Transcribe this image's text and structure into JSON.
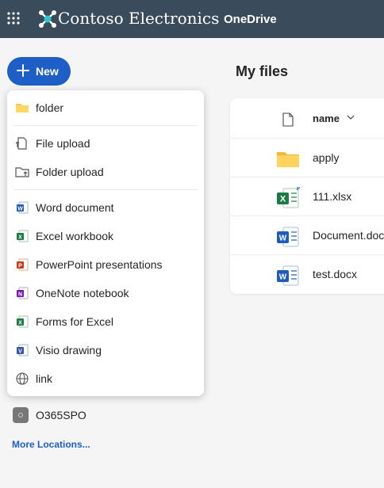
{
  "header": {
    "brand": "Contoso Electronics",
    "app_name": "OneDrive",
    "brand_color": "#3a4b5c"
  },
  "new_button": {
    "label": "New",
    "color": "#1d5fc6"
  },
  "new_menu": {
    "items": [
      {
        "label": "folder",
        "icon": "folder-icon"
      },
      {
        "label": "File upload",
        "icon": "file-upload-icon"
      },
      {
        "label": "Folder upload",
        "icon": "folder-upload-icon"
      },
      {
        "label": "Word document",
        "icon": "word-icon"
      },
      {
        "label": "Excel workbook",
        "icon": "excel-icon"
      },
      {
        "label": "PowerPoint presentations",
        "icon": "powerpoint-icon"
      },
      {
        "label": "OneNote notebook",
        "icon": "onenote-icon"
      },
      {
        "label": "Forms for Excel",
        "icon": "forms-excel-icon"
      },
      {
        "label": "Visio drawing",
        "icon": "visio-icon"
      },
      {
        "label": "link",
        "icon": "globe-icon"
      }
    ]
  },
  "locations": {
    "site": "O365SPO",
    "more": "More Locations..."
  },
  "main": {
    "title": "My files",
    "column_name": "name",
    "files": [
      {
        "name": "apply",
        "icon": "folder-icon"
      },
      {
        "name": "111.xlsx",
        "icon": "excel-file-icon"
      },
      {
        "name": "Document.docx",
        "icon": "word-file-icon"
      },
      {
        "name": "test.docx",
        "icon": "word-file-icon"
      }
    ]
  }
}
